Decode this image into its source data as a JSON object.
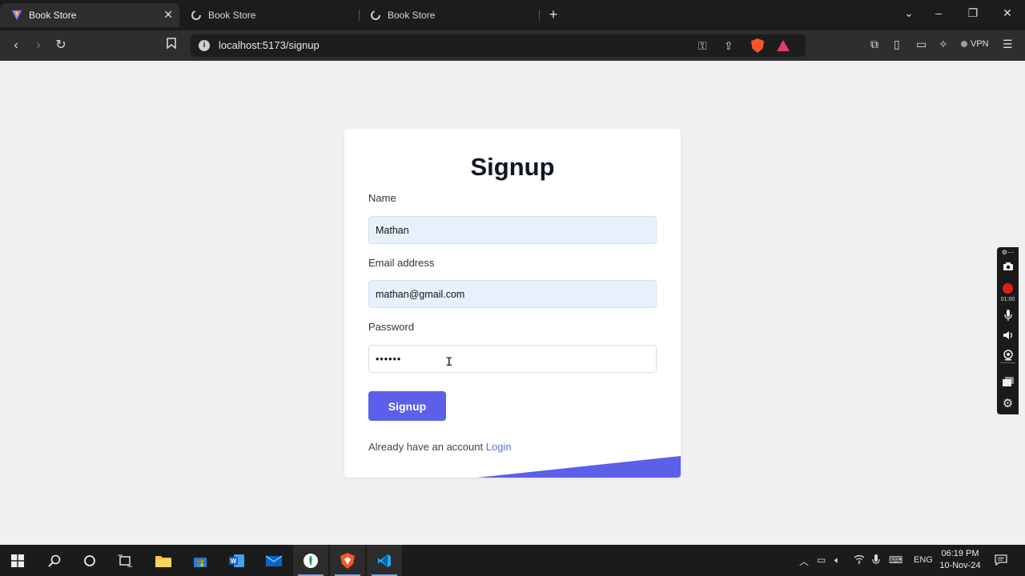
{
  "browser": {
    "tabs": [
      {
        "title": "Book Store",
        "active": true
      },
      {
        "title": "Book Store",
        "active": false
      },
      {
        "title": "Book Store",
        "active": false
      }
    ],
    "url": "localhost:5173/signup",
    "vpn_label": "VPN"
  },
  "form": {
    "title": "Signup",
    "name_label": "Name",
    "name_value": "Mathan",
    "email_label": "Email address",
    "email_value": "mathan@gmail.com",
    "password_label": "Password",
    "password_value": "••••••",
    "submit_label": "Signup",
    "login_prompt": "Already have an account",
    "login_link": "Login"
  },
  "recorder": {
    "timer": "01:00"
  },
  "taskbar": {
    "language": "ENG",
    "time": "06:19 PM",
    "date": "10-Nov-24"
  },
  "colors": {
    "accent": "#5b5fe9",
    "link": "#5b6fd6",
    "autofill": "#e8f0fe",
    "record": "#e02020"
  }
}
